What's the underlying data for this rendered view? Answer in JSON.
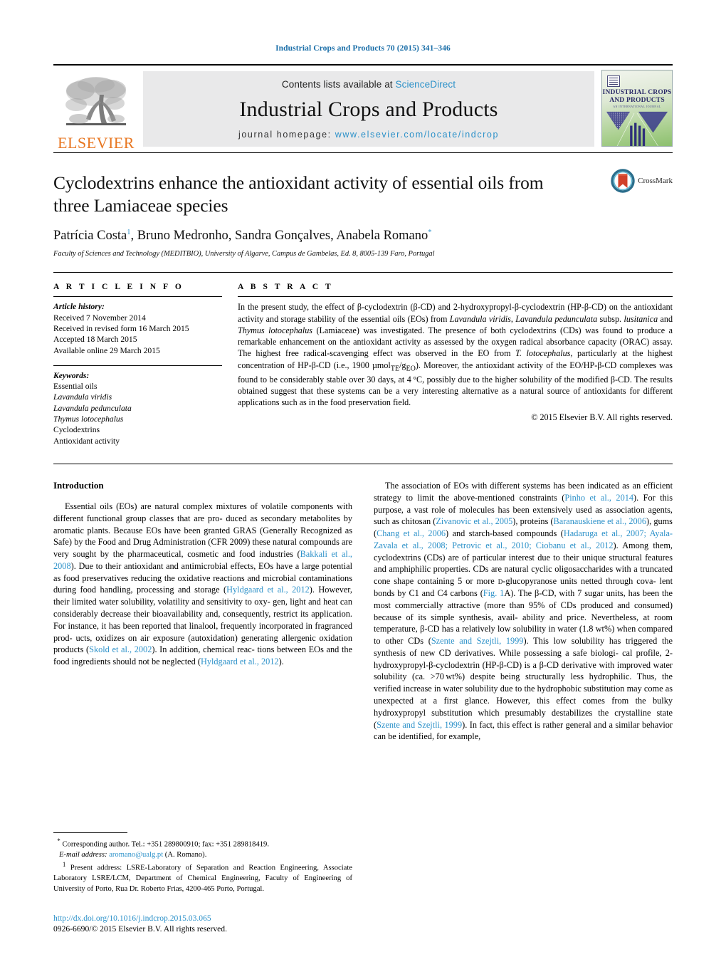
{
  "running_head": "Industrial Crops and Products 70 (2015) 341–346",
  "masthead": {
    "publisher_name": "ELSEVIER",
    "contents_prefix": "Contents lists available at ",
    "contents_link": "ScienceDirect",
    "journal_title": "Industrial Crops and Products",
    "homepage_prefix": "journal homepage: ",
    "homepage_url": "www.elsevier.com/locate/indcrop",
    "cover": {
      "title_line1": "INDUSTRIAL CROPS",
      "title_line2": "AND PRODUCTS",
      "subtitle": "AN INTERNATIONAL JOURNAL"
    }
  },
  "article": {
    "title": "Cyclodextrins enhance the antioxidant activity of essential oils from three Lamiaceae species",
    "authors": [
      {
        "name": "Patrícia Costa",
        "mark": "1"
      },
      {
        "name": "Bruno Medronho",
        "mark": ""
      },
      {
        "name": "Sandra Gonçalves",
        "mark": ""
      },
      {
        "name": "Anabela Romano",
        "mark": "*"
      }
    ],
    "affiliation": "Faculty of Sciences and Technology (MEDITBIO), University of Algarve, Campus de Gambelas, Ed. 8, 8005-139 Faro, Portugal",
    "crossmark_label": "CrossMark"
  },
  "article_info": {
    "heading": "A R T I C L E   I N F O",
    "history_label": "Article history:",
    "history": [
      "Received 7 November 2014",
      "Received in revised form 16 March 2015",
      "Accepted 18 March 2015",
      "Available online 29 March 2015"
    ],
    "keywords_label": "Keywords:",
    "keywords": [
      "Essential oils",
      "Lavandula viridis",
      "Lavandula pedunculata",
      "Thymus lotocephalus",
      "Cyclodextrins",
      "Antioxidant activity"
    ]
  },
  "abstract": {
    "heading": "A B S T R A C T",
    "copyright": "© 2015 Elsevier B.V. All rights reserved."
  },
  "introduction": {
    "heading": "Introduction"
  },
  "footnotes": {
    "corresponding": "Corresponding author. Tel.: +351 289800910; fax: +351 289818419.",
    "email_label": "E-mail address:",
    "email": "aromano@ualg.pt",
    "email_owner": "(A. Romano).",
    "present_address": "Present address: LSRE-Laboratory of Separation and Reaction Engineering, Associate Laboratory LSRE/LCM, Department of Chemical Engineering, Faculty of Engineering of University of Porto, Rua Dr. Roberto Frias, 4200-465 Porto, Portugal."
  },
  "publication": {
    "doi": "http://dx.doi.org/10.1016/j.indcrop.2015.03.065",
    "issn_line": "0926-6690/© 2015 Elsevier B.V. All rights reserved."
  },
  "colors": {
    "link_blue": "#2c91c9",
    "running_head_blue": "#1a6ea8",
    "elsevier_orange": "#E87722",
    "band_gray": "#e9e9ea"
  }
}
